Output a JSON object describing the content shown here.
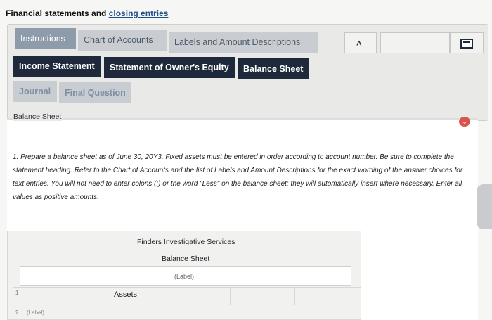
{
  "page": {
    "title_prefix": "Financial statements and ",
    "title_link": "closing entries"
  },
  "tabs": {
    "row1": [
      "Instructions",
      "Chart of Accounts",
      "Labels and Amount Descriptions"
    ],
    "row2": [
      "Income Statement",
      "Statement of Owner's Equity",
      "Balance Sheet"
    ],
    "row3": [
      "Journal",
      "Final Question"
    ]
  },
  "nav": {
    "prev_icon": "chevron-up-icon",
    "menu_icon": "menu-icon"
  },
  "section_label": "Balance Sheet",
  "instructions": "1. Prepare a balance sheet as of June 30, 20Y3. Fixed assets must be entered in order according to account number. Be sure to complete the statement heading. Refer to the Chart of Accounts and the list of Labels and Amount Descriptions for the exact wording of the answer choices for text entries. You will not need to enter colons (:) or the word \"Less\" on the balance sheet; they will automatically insert where necessary. Enter all values as positive amounts.",
  "statement": {
    "company": "Finders Investigative Services",
    "title": "Balance Sheet",
    "label_placeholder": "(Label)",
    "rows": [
      {
        "num": "1",
        "text": "Assets"
      },
      {
        "num": "2",
        "text": "(Label)"
      }
    ]
  },
  "colors": {
    "tab_dark": "#1e2a3b",
    "tab_light": "#c9ccd0",
    "alert": "#d9534f"
  }
}
